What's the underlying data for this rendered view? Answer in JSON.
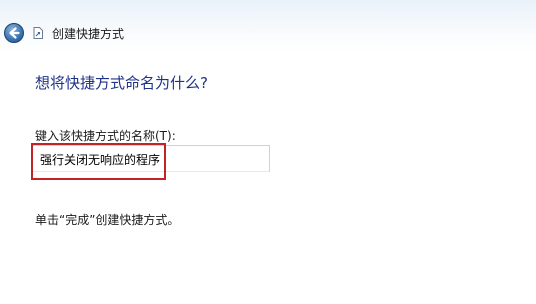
{
  "titlebar": {
    "back_icon": "back-arrow-icon",
    "app_icon": "shortcut-icon",
    "title": "创建快捷方式"
  },
  "main": {
    "heading": "想将快捷方式命名为什么?",
    "name_field": {
      "label": "键入该快捷方式的名称(T):",
      "value": "强行关闭无响应的程序"
    },
    "instruction": "单击“完成”创建快捷方式。"
  },
  "colors": {
    "heading": "#1e3287",
    "highlight": "#c22326",
    "back_button": "#3e77b3"
  }
}
